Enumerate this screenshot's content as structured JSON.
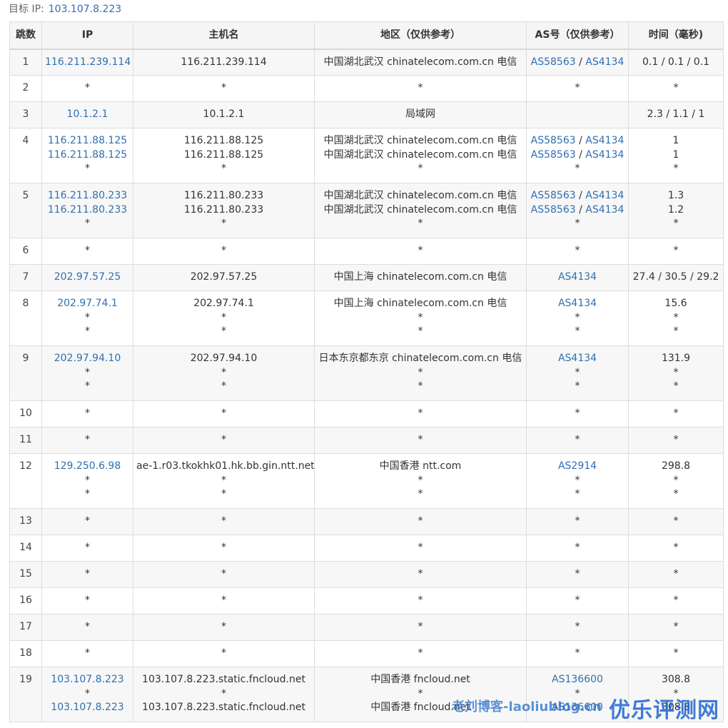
{
  "target": {
    "label": "目标 IP:",
    "ip": "103.107.8.223"
  },
  "headers": {
    "hop": "跳数",
    "ip": "IP",
    "host": "主机名",
    "region": "地区（仅供参考）",
    "as": "AS号（仅供参考）",
    "time": "时间（毫秒)"
  },
  "rows": [
    {
      "hop": "1",
      "ip": [
        "116.211.239.114"
      ],
      "host": [
        "116.211.239.114"
      ],
      "region": [
        "中国湖北武汉 chinatelecom.com.cn 电信"
      ],
      "as": [
        [
          "AS58563",
          "AS4134"
        ]
      ],
      "time": [
        "0.1 / 0.1 / 0.1"
      ]
    },
    {
      "hop": "2",
      "ip": [
        "*"
      ],
      "host": [
        "*"
      ],
      "region": [
        "*"
      ],
      "as": [
        [
          "*"
        ]
      ],
      "time": [
        "*"
      ]
    },
    {
      "hop": "3",
      "ip": [
        "10.1.2.1"
      ],
      "host": [
        "10.1.2.1"
      ],
      "region": [
        "局域网"
      ],
      "as": [
        []
      ],
      "time": [
        "2.3 / 1.1 / 1"
      ]
    },
    {
      "hop": "4",
      "ip": [
        "116.211.88.125",
        "116.211.88.125",
        "*"
      ],
      "host": [
        "116.211.88.125",
        "116.211.88.125",
        "*"
      ],
      "region": [
        "中国湖北武汉 chinatelecom.com.cn 电信",
        "中国湖北武汉 chinatelecom.com.cn 电信",
        "*"
      ],
      "as": [
        [
          "AS58563",
          "AS4134"
        ],
        [
          "AS58563",
          "AS4134"
        ],
        [
          "*"
        ]
      ],
      "time": [
        "1",
        "1",
        "*"
      ]
    },
    {
      "hop": "5",
      "ip": [
        "116.211.80.233",
        "116.211.80.233",
        "*"
      ],
      "host": [
        "116.211.80.233",
        "116.211.80.233",
        "*"
      ],
      "region": [
        "中国湖北武汉 chinatelecom.com.cn 电信",
        "中国湖北武汉 chinatelecom.com.cn 电信",
        "*"
      ],
      "as": [
        [
          "AS58563",
          "AS4134"
        ],
        [
          "AS58563",
          "AS4134"
        ],
        [
          "*"
        ]
      ],
      "time": [
        "1.3",
        "1.2",
        "*"
      ]
    },
    {
      "hop": "6",
      "ip": [
        "*"
      ],
      "host": [
        "*"
      ],
      "region": [
        "*"
      ],
      "as": [
        [
          "*"
        ]
      ],
      "time": [
        "*"
      ]
    },
    {
      "hop": "7",
      "ip": [
        "202.97.57.25"
      ],
      "host": [
        "202.97.57.25"
      ],
      "region": [
        "中国上海 chinatelecom.com.cn 电信"
      ],
      "as": [
        [
          "AS4134"
        ]
      ],
      "time": [
        "27.4 / 30.5 / 29.2"
      ]
    },
    {
      "hop": "8",
      "ip": [
        "202.97.74.1",
        "*",
        "*"
      ],
      "host": [
        "202.97.74.1",
        "*",
        "*"
      ],
      "region": [
        "中国上海 chinatelecom.com.cn 电信",
        "*",
        "*"
      ],
      "as": [
        [
          "AS4134"
        ],
        [
          "*"
        ],
        [
          "*"
        ]
      ],
      "time": [
        "15.6",
        "*",
        "*"
      ]
    },
    {
      "hop": "9",
      "ip": [
        "202.97.94.10",
        "*",
        "*"
      ],
      "host": [
        "202.97.94.10",
        "*",
        "*"
      ],
      "region": [
        "日本东京都东京 chinatelecom.com.cn 电信",
        "*",
        "*"
      ],
      "as": [
        [
          "AS4134"
        ],
        [
          "*"
        ],
        [
          "*"
        ]
      ],
      "time": [
        "131.9",
        "*",
        "*"
      ]
    },
    {
      "hop": "10",
      "ip": [
        "*"
      ],
      "host": [
        "*"
      ],
      "region": [
        "*"
      ],
      "as": [
        [
          "*"
        ]
      ],
      "time": [
        "*"
      ]
    },
    {
      "hop": "11",
      "ip": [
        "*"
      ],
      "host": [
        "*"
      ],
      "region": [
        "*"
      ],
      "as": [
        [
          "*"
        ]
      ],
      "time": [
        "*"
      ]
    },
    {
      "hop": "12",
      "ip": [
        "129.250.6.98",
        "*",
        "*"
      ],
      "host": [
        "ae-1.r03.tkokhk01.hk.bb.gin.ntt.net",
        "*",
        "*"
      ],
      "region": [
        "中国香港 ntt.com",
        "*",
        "*"
      ],
      "as": [
        [
          "AS2914"
        ],
        [
          "*"
        ],
        [
          "*"
        ]
      ],
      "time": [
        "298.8",
        "*",
        "*"
      ]
    },
    {
      "hop": "13",
      "ip": [
        "*"
      ],
      "host": [
        "*"
      ],
      "region": [
        "*"
      ],
      "as": [
        [
          "*"
        ]
      ],
      "time": [
        "*"
      ]
    },
    {
      "hop": "14",
      "ip": [
        "*"
      ],
      "host": [
        "*"
      ],
      "region": [
        "*"
      ],
      "as": [
        [
          "*"
        ]
      ],
      "time": [
        "*"
      ]
    },
    {
      "hop": "15",
      "ip": [
        "*"
      ],
      "host": [
        "*"
      ],
      "region": [
        "*"
      ],
      "as": [
        [
          "*"
        ]
      ],
      "time": [
        "*"
      ]
    },
    {
      "hop": "16",
      "ip": [
        "*"
      ],
      "host": [
        "*"
      ],
      "region": [
        "*"
      ],
      "as": [
        [
          "*"
        ]
      ],
      "time": [
        "*"
      ]
    },
    {
      "hop": "17",
      "ip": [
        "*"
      ],
      "host": [
        "*"
      ],
      "region": [
        "*"
      ],
      "as": [
        [
          "*"
        ]
      ],
      "time": [
        "*"
      ]
    },
    {
      "hop": "18",
      "ip": [
        "*"
      ],
      "host": [
        "*"
      ],
      "region": [
        "*"
      ],
      "as": [
        [
          "*"
        ]
      ],
      "time": [
        "*"
      ]
    },
    {
      "hop": "19",
      "ip": [
        "103.107.8.223",
        "*",
        "103.107.8.223"
      ],
      "host": [
        "103.107.8.223.static.fncloud.net",
        "*",
        "103.107.8.223.static.fncloud.net"
      ],
      "region": [
        "中国香港 fncloud.net",
        "*",
        "中国香港 fncloud.net"
      ],
      "as": [
        [
          "AS136600"
        ],
        [
          "*"
        ],
        [
          "AS136600"
        ]
      ],
      "time": [
        "308.8",
        "*",
        "308.8"
      ]
    }
  ],
  "watermark": {
    "text1": "老刘博客-laoliublog.cn",
    "text2": "优乐评测网"
  }
}
